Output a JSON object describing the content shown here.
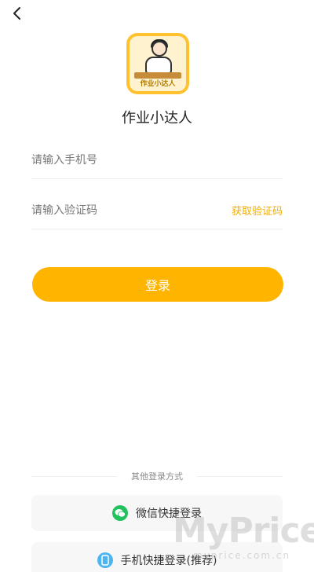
{
  "header": {
    "back_icon": "chevron-left-icon"
  },
  "app": {
    "name": "作业小达人",
    "logo_caption": "作业小达人"
  },
  "form": {
    "phone_placeholder": "请输入手机号",
    "code_placeholder": "请输入验证码",
    "get_code_label": "获取验证码",
    "login_label": "登录"
  },
  "other_login": {
    "divider_text": "其他登录方式",
    "wechat_label": "微信快捷登录",
    "wechat_icon": "wechat-icon",
    "mobile_label": "手机快捷登录(推荐)",
    "mobile_icon": "phone-icon"
  },
  "watermark": {
    "brand": "MyPrice",
    "domain": "myprice.com.cn"
  },
  "colors": {
    "accent": "#ffb400",
    "accent_text": "#f2ad00",
    "wechat": "#22c15e",
    "mobile": "#4fb5f0"
  }
}
